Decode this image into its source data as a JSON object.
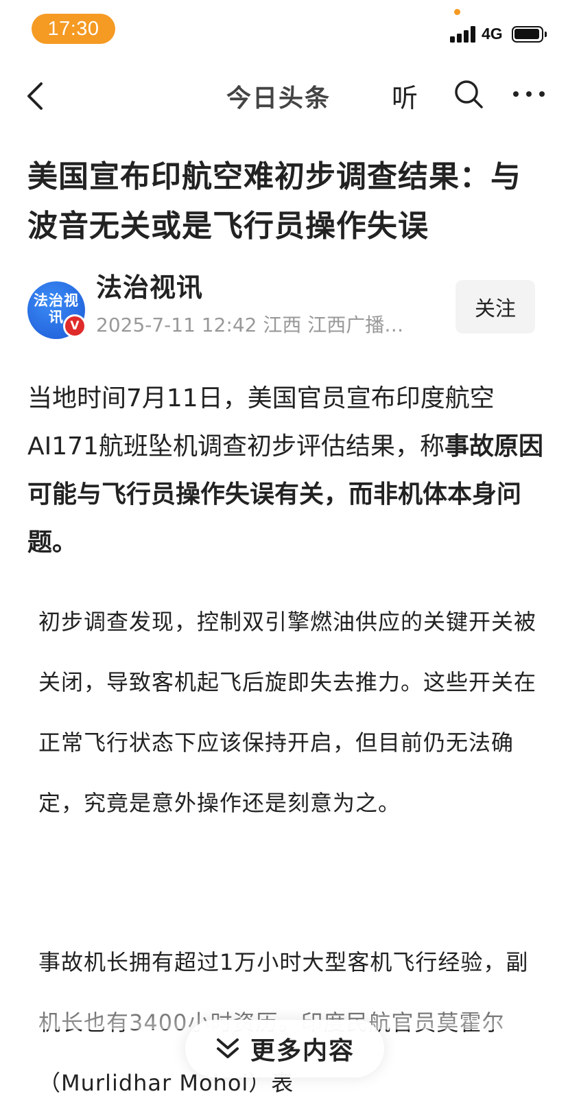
{
  "status_bar": {
    "time": "17:30",
    "network": "4G"
  },
  "nav": {
    "title": "今日头条",
    "listen_label": "听"
  },
  "article": {
    "title": "美国宣布印航空难初步调查结果：与波音无关或是飞行员操作失误",
    "author": {
      "avatar_text": "法治视讯",
      "verified_badge": "V",
      "name": "法治视讯",
      "meta": "2025-7-11 12:42 江西 江西广播…",
      "follow_label": "关注"
    },
    "lead": {
      "normal": "当地时间7月11日，美国官员宣布印度航空AI171航班坠机调查初步评估结果，称",
      "bold": "事故原因可能与飞行员操作失误有关，而非机体本身问题。"
    },
    "paragraphs": [
      "初步调查发现，控制双引擎燃油供应的关键开关被关闭，导致客机起飞后旋即失去推力。这些开关在正常飞行状态下应该保持开启，但目前仍无法确定，究竟是意外操作还是刻意为之。",
      "事故机长拥有超过1万小时大型客机飞行经验，副机长也有3400小时资历。印度民航官员莫霍尔（Murlidhar Mohol）表"
    ]
  },
  "more_button": {
    "label": "更多内容",
    "icon": "double-chevron-down-icon"
  },
  "colors": {
    "accent": "#f59a23",
    "badge_red": "#e02b2b",
    "avatar_blue": "#1b59d6"
  }
}
